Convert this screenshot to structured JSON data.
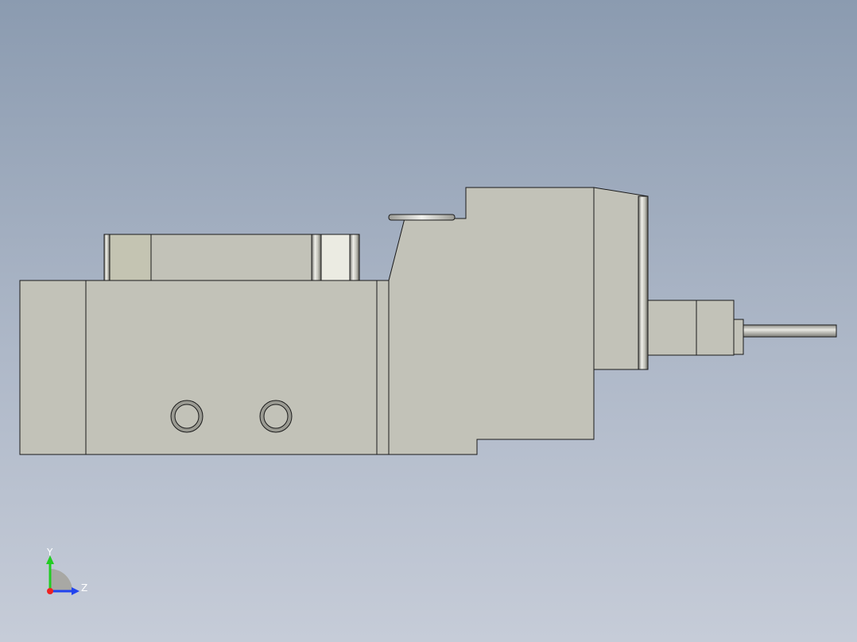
{
  "viewport": {
    "background_top": "#8b9bb0",
    "background_bottom": "#c6ccd8",
    "part_face_color": "#c2c2b8",
    "part_edge_color": "#1a1a1a"
  },
  "triad": {
    "y_label": "Y",
    "z_label": "Z",
    "y_axis_color": "#22cc22",
    "z_axis_color": "#2244ee",
    "x_axis_color": "#ee2222"
  }
}
